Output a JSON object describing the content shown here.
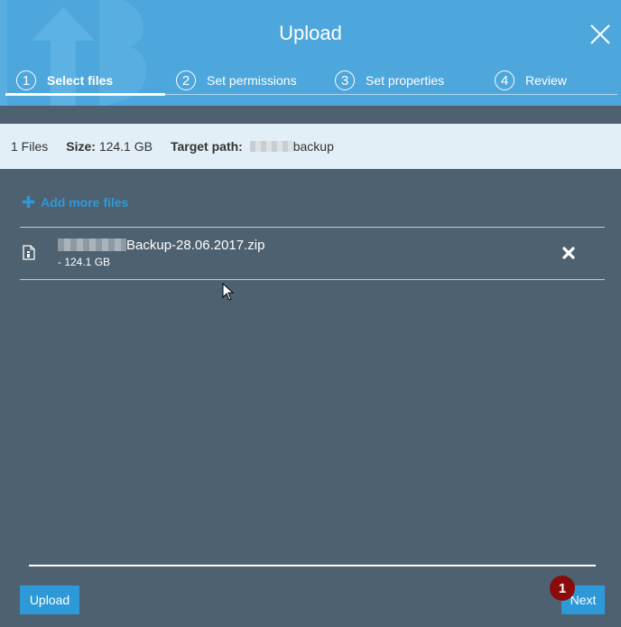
{
  "dialog": {
    "title": "Upload",
    "close_icon": "close-icon"
  },
  "steps": [
    {
      "number": "1",
      "label": "Select files",
      "active": true
    },
    {
      "number": "2",
      "label": "Set permissions",
      "active": false
    },
    {
      "number": "3",
      "label": "Set properties",
      "active": false
    },
    {
      "number": "4",
      "label": "Review",
      "active": false
    }
  ],
  "summary": {
    "files_count": "1 Files",
    "size_label": "Size:",
    "size_value": "124.1 GB",
    "target_label": "Target path:",
    "target_value": "backup"
  },
  "add_more": {
    "icon": "plus-icon",
    "label": "Add more files"
  },
  "files": [
    {
      "name": "Backup-28.06.2017.zip",
      "size": "- 124.1 GB",
      "icon": "zip-file-icon"
    }
  ],
  "footer": {
    "upload_label": "Upload",
    "next_label": "Next",
    "badge": "1"
  },
  "colors": {
    "header": "#4da6dc",
    "body": "#4d6170",
    "accent": "#2e99d8",
    "info_bar": "#e3eff6",
    "badge": "#8b0a0a"
  }
}
